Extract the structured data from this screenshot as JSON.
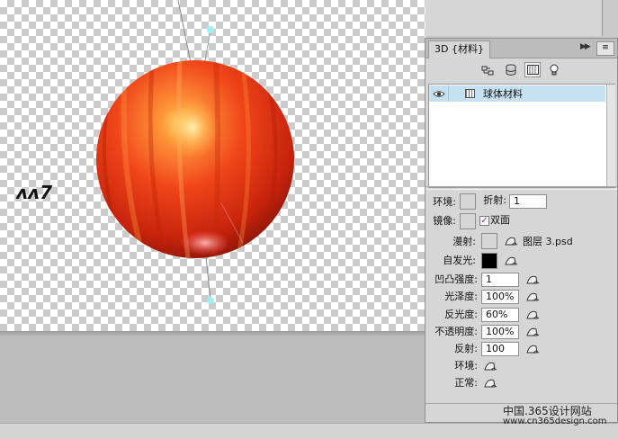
{
  "panel": {
    "tab_label": "3D {材料}",
    "collapse_glyph": "▶▶",
    "menu_glyph": "≡",
    "tools": [
      "scene-icon",
      "mesh-icon",
      "material-icon",
      "light-icon"
    ],
    "active_tool": "material-icon",
    "material_name": "球体材料"
  },
  "properties": {
    "environment_label": "环境:",
    "refraction_label": "折射:",
    "refraction_value": "1",
    "reflection_label": "镜像:",
    "double_sided_label": "双面",
    "double_sided_checked": true,
    "diffuse_label": "漫射:",
    "diffuse_texture": "图层 3.psd",
    "self_illum_label": "自发光:",
    "self_illum_color": "#000000",
    "bump_label": "凹凸强度:",
    "bump_value": "1",
    "glossiness_label": "光泽度:",
    "glossiness_value": "100%",
    "shine_label": "反光度:",
    "shine_value": "60%",
    "opacity_label": "不透明度:",
    "opacity_value": "100%",
    "reflectivity_label": "反射:",
    "reflectivity_value": "100",
    "env_map_label": "环境:",
    "normal_label": "正常:"
  },
  "watermark": {
    "line1": "中国.365设计网站",
    "line2": "www.cn365design.com",
    "logo_text": "ᴧᴧ7"
  },
  "colors": {
    "selection": "#c6e2f2",
    "ball": "#e8401a",
    "check": "#8a2aa8"
  }
}
